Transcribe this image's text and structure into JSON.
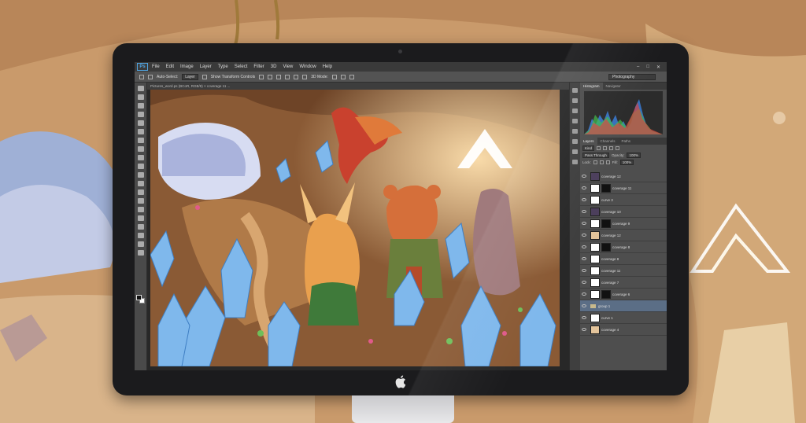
{
  "app": {
    "logo_text": "Ps"
  },
  "menubar": {
    "items": [
      "File",
      "Edit",
      "Image",
      "Layer",
      "Type",
      "Select",
      "Filter",
      "3D",
      "View",
      "Window",
      "Help"
    ]
  },
  "window_controls": [
    "–",
    "□",
    "✕"
  ],
  "options_bar": {
    "auto_select_label": "Auto-Select:",
    "auto_select_value": "Layer",
    "transform_label": "Show Transform Controls",
    "mode_3d_label": "3D Mode:",
    "workspace_value": "Photography"
  },
  "document": {
    "tab_title": "Pictures_word.ps (BCoR, RGB/8) × coverage 11 ..."
  },
  "panels": {
    "top_tabs": [
      "Histogram",
      "Navigator"
    ],
    "layer_tabs": [
      "Layers",
      "Channels",
      "Paths"
    ],
    "kind_filter": "Kind",
    "blend_mode": "Pass Through",
    "opacity_label": "Opacity:",
    "opacity_value": "100%",
    "lock_label": "Lock:",
    "fill_label": "Fill:",
    "fill_value": "100%"
  },
  "layers": [
    {
      "name": "coverage 12",
      "thumb": "dark",
      "mask": false,
      "selected": false
    },
    {
      "name": "coverage 11",
      "thumb": "white",
      "mask": true,
      "selected": false
    },
    {
      "name": "curve 3",
      "thumb": "white",
      "mask": false,
      "selected": false
    },
    {
      "name": "coverage 10",
      "thumb": "dark",
      "mask": false,
      "selected": false
    },
    {
      "name": "coverage 9",
      "thumb": "white",
      "mask": true,
      "selected": false
    },
    {
      "name": "coverage 12",
      "thumb": "tan",
      "mask": false,
      "selected": false
    },
    {
      "name": "coverage 8",
      "thumb": "white",
      "mask": true,
      "selected": false
    },
    {
      "name": "coverage 8",
      "thumb": "white",
      "mask": false,
      "selected": false
    },
    {
      "name": "coverage 11",
      "thumb": "white",
      "mask": false,
      "selected": false
    },
    {
      "name": "coverage 7",
      "thumb": "white",
      "mask": false,
      "selected": false
    },
    {
      "name": "coverage 6",
      "thumb": "white",
      "mask": true,
      "selected": false
    },
    {
      "name": "group 1",
      "thumb": "folder",
      "mask": false,
      "selected": true
    },
    {
      "name": "curve 1",
      "thumb": "white",
      "mask": false,
      "selected": false
    },
    {
      "name": "coverage 4",
      "thumb": "tan",
      "mask": false,
      "selected": false
    }
  ],
  "colors": {
    "ps_accent": "#4fa3e0",
    "selected_layer": "#5b6e86",
    "cave_brown": "#8a5a35",
    "crystal_blue": "#7fb8ec"
  }
}
